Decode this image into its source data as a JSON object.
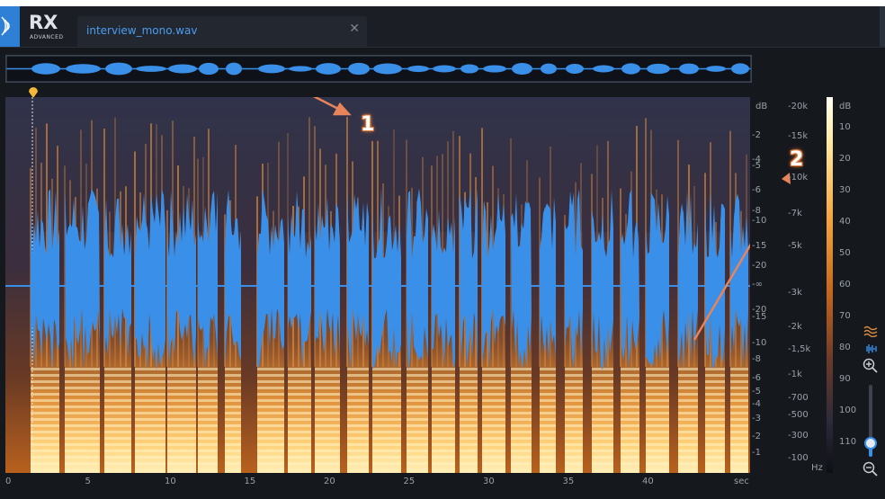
{
  "app": {
    "logo": "RX",
    "logo_sub": "ADVANCED"
  },
  "tab": {
    "filename": "interview_mono.wav",
    "close": "✕"
  },
  "db_scale": {
    "unit": "dB",
    "ticks": [
      "-2",
      "-4",
      "-5",
      "-6",
      "-8",
      "-10",
      "-15",
      "-20",
      "-∞",
      "-20",
      "-15",
      "-10",
      "-8",
      "-6",
      "-5",
      "-4",
      "-3",
      "-2",
      "-1"
    ]
  },
  "hz_scale": {
    "unit": "Hz",
    "ticks": [
      "-20k",
      "-15k",
      "-10k",
      "-7k",
      "-5k",
      "-3k",
      "-2k",
      "-1,5k",
      "-1k",
      "-700",
      "-500",
      "-300",
      "-100"
    ]
  },
  "color_scale": {
    "unit": "dB",
    "ticks": [
      "10",
      "20",
      "30",
      "40",
      "50",
      "60",
      "70",
      "80",
      "90",
      "100",
      "110"
    ]
  },
  "time_axis": {
    "unit": "sec",
    "ticks": [
      "0",
      "5",
      "10",
      "15",
      "20",
      "25",
      "30",
      "35",
      "40"
    ]
  },
  "callouts": [
    {
      "number": "1"
    },
    {
      "number": "2"
    }
  ],
  "colors": {
    "waveform": "#3a8fe8",
    "accent": "#2e7fd6",
    "callout": "#e8845a"
  },
  "right_tools": [
    {
      "icon": "spectrogram-view-icon"
    },
    {
      "icon": "waveform-view-icon"
    },
    {
      "icon": "zoom-in-icon"
    },
    {
      "icon": "zoom-out-icon"
    }
  ],
  "zoom_slider": {
    "level": 0.22
  }
}
